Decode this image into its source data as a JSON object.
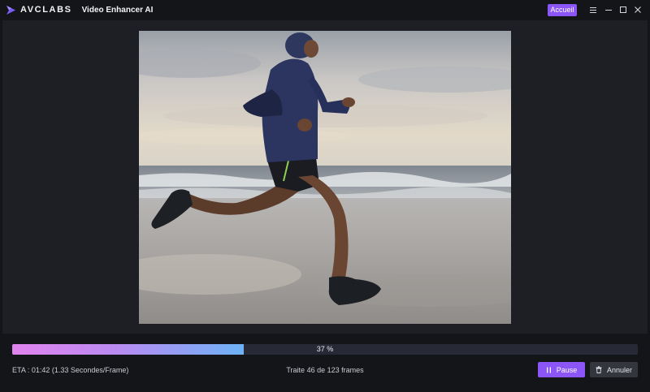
{
  "titlebar": {
    "brand": "AVCLABS",
    "app_name": "Video Enhancer AI",
    "home_button": "Accueil",
    "controls": [
      "menu-icon",
      "minimize-icon",
      "maximize-icon",
      "close-icon"
    ]
  },
  "preview": {
    "description_icon": "video-preview"
  },
  "progress": {
    "percent": 37,
    "label": "37 %"
  },
  "status": {
    "eta": "ETA : 01:42 (1.33 Secondes/Frame)",
    "frames": "Traite 46 de 123 frames"
  },
  "actions": {
    "pause_label": "Pause",
    "pause_icon": "pause-icon",
    "cancel_label": "Annuler",
    "cancel_icon": "trash-icon"
  },
  "colors": {
    "accent": "#8b55f7",
    "background": "#141518",
    "panel": "#1e1f24",
    "progress_start": "#e283ee",
    "progress_end": "#6db2f5"
  }
}
